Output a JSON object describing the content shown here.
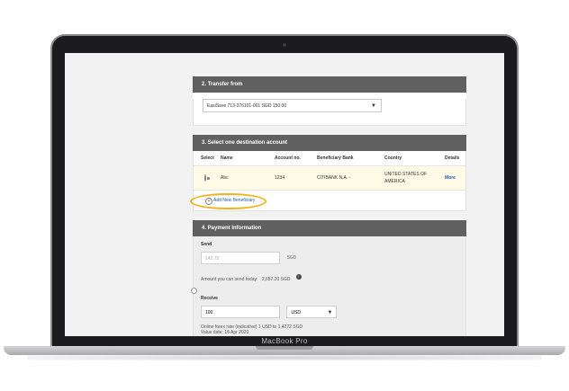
{
  "device": {
    "brand": "MacBook Pro"
  },
  "transfer_from": {
    "header": "2.  Transfer from",
    "account_value": "EasiSave 713-376101-001 SGD 150.00"
  },
  "destination": {
    "header": "3.  Select one destination account",
    "columns": [
      "Select",
      "Name",
      "Account no.",
      "Beneficiary Bank",
      "Country",
      "Details"
    ],
    "rows": [
      {
        "name": "Abc",
        "account_no": "1234",
        "bank": "CITIBANK N.A. -",
        "country": "UNITED STATES OF AMERICA",
        "details": "More"
      }
    ],
    "add_label": "Add New Beneficiary"
  },
  "payment": {
    "header": "4.  Payment Information",
    "send_label": "Send",
    "send_value": "142.72",
    "send_currency": "SGD",
    "limit_text": "Amount you can send today:",
    "limit_amount": "2,657.20 SGD",
    "receive_label": "Receive",
    "receive_value": "100",
    "receive_currency": "USD",
    "rate_text": "Online forex rate (indicative) 1 USD to 1.4272 SGD",
    "value_date": "Value date: 16 Apr 2020"
  },
  "colors": {
    "header_bg": "#606060",
    "link": "#1f5fa8",
    "highlight": "#f2b31a",
    "selected_row": "#fffbe6"
  }
}
